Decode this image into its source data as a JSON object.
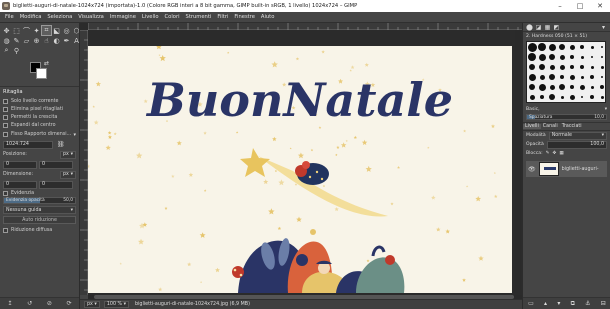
{
  "window": {
    "title": "biglietti-auguri-di-natale-1024x724 (importata)-1.0 (Colore RGB interi a 8 bit gamma, GIMP built-in sRGB, 1 livello) 1024x724 – GIMP",
    "minimize": "–",
    "maximize": "□",
    "close": "✕"
  },
  "menu": [
    "File",
    "Modifica",
    "Seleziona",
    "Visualizza",
    "Immagine",
    "Livello",
    "Colori",
    "Strumenti",
    "Filtri",
    "Finestre",
    "Aiuto"
  ],
  "toolbox": {
    "tools": [
      {
        "name": "move-tool-icon",
        "glyph": "✥"
      },
      {
        "name": "rect-select-tool-icon",
        "glyph": "⬚"
      },
      {
        "name": "lasso-tool-icon",
        "glyph": "⌒"
      },
      {
        "name": "fuzzy-select-tool-icon",
        "glyph": "✦"
      },
      {
        "name": "crop-tool-icon",
        "glyph": "⌗"
      },
      {
        "name": "unified-transform-tool-icon",
        "glyph": "⬕"
      },
      {
        "name": "warp-tool-icon",
        "glyph": "◎"
      },
      {
        "name": "cage-tool-icon",
        "glyph": "⬡"
      },
      {
        "name": "bucket-fill-tool-icon",
        "glyph": "◍"
      },
      {
        "name": "paintbrush-tool-icon",
        "glyph": "✎"
      },
      {
        "name": "eraser-tool-icon",
        "glyph": "▱"
      },
      {
        "name": "clone-tool-icon",
        "glyph": "⊕"
      },
      {
        "name": "smudge-tool-icon",
        "glyph": "☝"
      },
      {
        "name": "dodge-tool-icon",
        "glyph": "◐"
      },
      {
        "name": "paths-tool-icon",
        "glyph": "✒"
      },
      {
        "name": "text-tool-icon",
        "glyph": "A"
      },
      {
        "name": "color-picker-tool-icon",
        "glyph": "⌕"
      },
      {
        "name": "zoom-tool-icon",
        "glyph": "⚲"
      }
    ],
    "swap_glyph": "⇄",
    "options": {
      "title": "Ritaglia",
      "checks": [
        "Solo livello corrente",
        "Elimina pixel ritagliati",
        "Permetti la crescita",
        "Espandi dal centro"
      ],
      "fixed_label": "Fisso Rapporto dimensi...",
      "ratio_value": "1024:724",
      "position_label": "Posizione:",
      "position_unit": "px",
      "position_x": "0",
      "position_y": "0",
      "size_label": "Dimensione:",
      "size_unit": "px",
      "size_w": "0",
      "size_h": "0",
      "highlight_label": "Evidenzia",
      "highlight_opacity_label": "Evidenzia opacità",
      "highlight_opacity_value": "50,0",
      "highlight_opacity_fraction": 0.5,
      "guides_value": "Nessuna guida",
      "auto_shrink": "Auto riduzione",
      "merged_label": "Riduzione diffusa"
    },
    "bottom_icons": [
      "↥",
      "↺",
      "⊘",
      "⟳"
    ]
  },
  "dock": {
    "tab_icons": [
      "⬤",
      "◪",
      "▦",
      "◩",
      "▾"
    ],
    "brush_name": "2. Hardness 050 (51 × 51)",
    "brush_category": "Basic,",
    "spacing_label": "Spaziatura",
    "spacing_value": "10,0",
    "spacing_fraction": 0.1,
    "layer_tabs": [
      "Livelli",
      "Canali",
      "Tracciati"
    ],
    "mode_label": "Modalità",
    "mode_value": "Normale",
    "opacity_label": "Opacità",
    "opacity_value": "100,0",
    "lock_label": "Blocca:",
    "layer_name": "biglietti-auguri-",
    "bottom_icons": [
      "▭",
      "▴",
      "▾",
      "⧉",
      "⚓",
      "⊟"
    ]
  },
  "statusbar": {
    "unit": "px",
    "zoom": "100 %",
    "filename": "biglietti-auguri-di-natale-1024x724.jpg (6,9 MB)"
  },
  "image": {
    "headline": "BuonNatale",
    "text_color": "#2a3466",
    "bg_color": "#f8f4e8",
    "star_color": "#e6c46a"
  }
}
